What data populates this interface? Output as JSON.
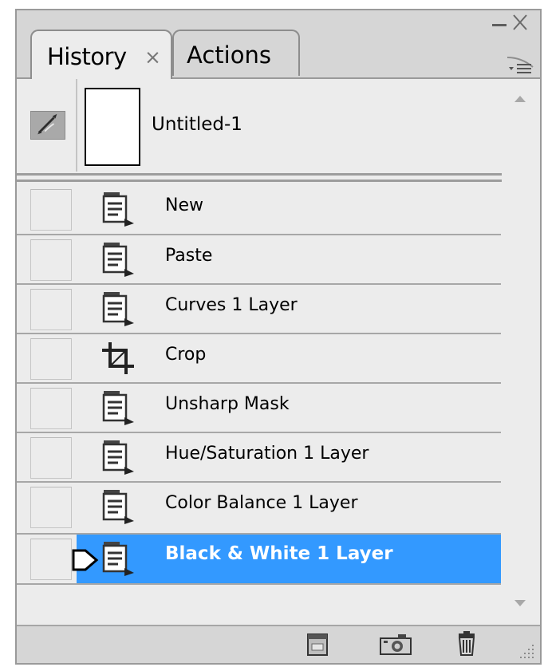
{
  "tabs": [
    {
      "label": "History",
      "close_glyph": "×",
      "active": true
    },
    {
      "label": "Actions",
      "active": false
    }
  ],
  "snapshot": {
    "name": "Untitled-1",
    "icon": "history-brush-source-icon"
  },
  "states": [
    {
      "label": "New",
      "icon": "history-state-icon"
    },
    {
      "label": "Paste",
      "icon": "history-state-icon"
    },
    {
      "label": "Curves 1 Layer",
      "icon": "history-state-icon"
    },
    {
      "label": "Crop",
      "icon": "crop-icon"
    },
    {
      "label": "Unsharp Mask",
      "icon": "history-state-icon"
    },
    {
      "label": "Hue/Saturation 1 Layer",
      "icon": "history-state-icon"
    },
    {
      "label": "Color Balance 1 Layer",
      "icon": "history-state-icon"
    },
    {
      "label": "Black & White 1 Layer",
      "icon": "history-state-icon",
      "selected": true
    }
  ],
  "footer_buttons": [
    "new-document-from-state-icon",
    "new-snapshot-icon",
    "delete-state-icon"
  ],
  "colors": {
    "selection": "#3399ff",
    "panel": "#d6d6d6",
    "list_bg": "#ececec"
  }
}
